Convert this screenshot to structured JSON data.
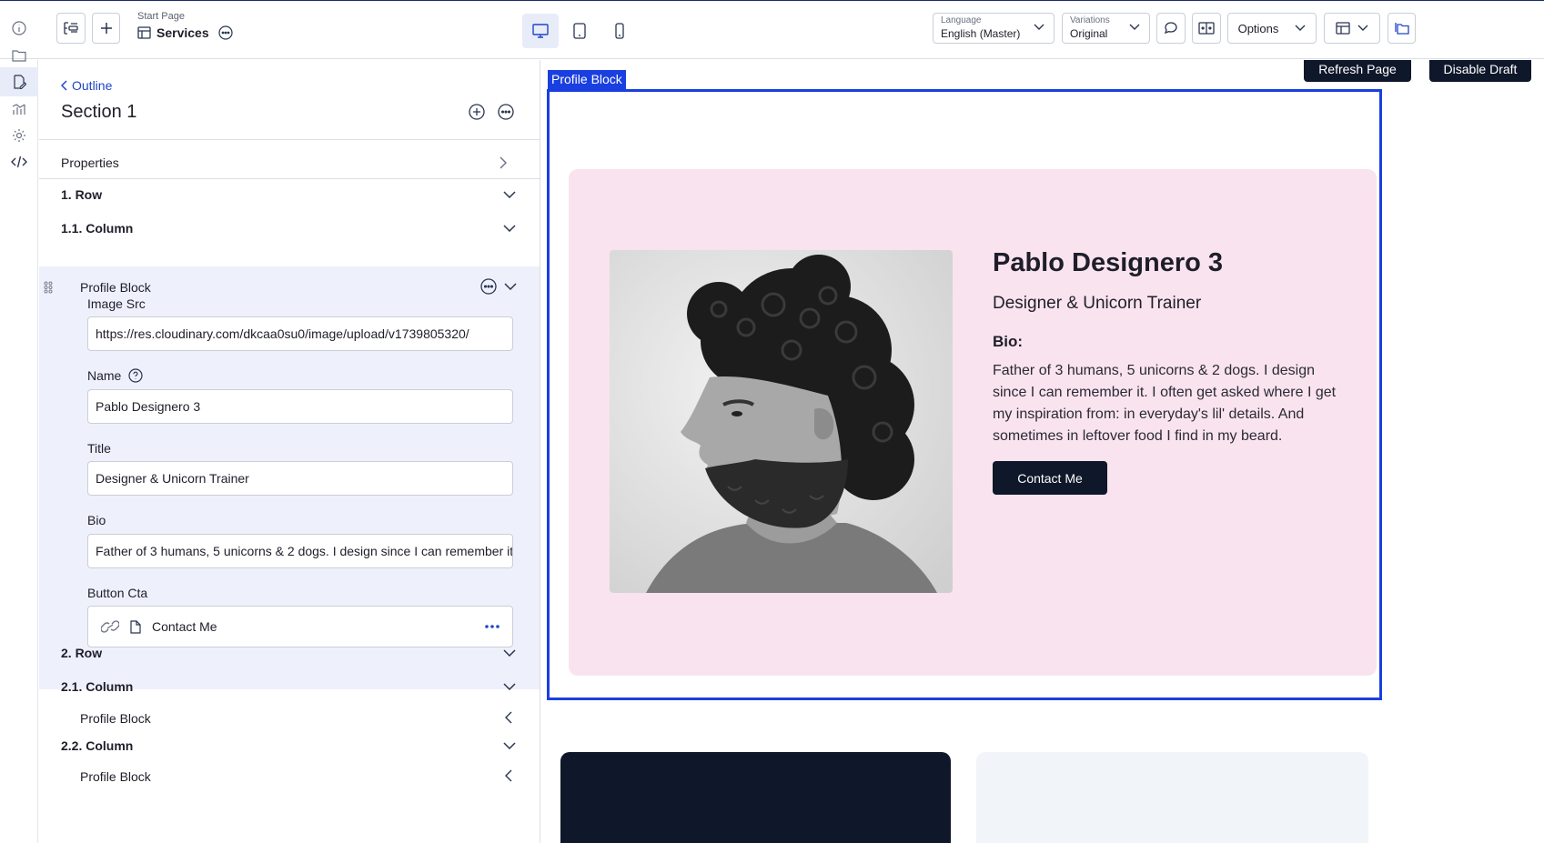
{
  "toolbar": {
    "breadcrumb_parent": "Start Page",
    "page_name": "Services",
    "language": {
      "label": "Language",
      "value": "English (Master)"
    },
    "variations": {
      "label": "Variations",
      "value": "Original"
    },
    "options_label": "Options"
  },
  "panel": {
    "outline_link": "Outline",
    "section_title": "Section 1",
    "properties_label": "Properties",
    "tree": [
      {
        "label": "1. Row"
      },
      {
        "label": "1.1. Column"
      }
    ],
    "profile_block": {
      "title": "Profile Block",
      "fields": {
        "image_src": {
          "label": "Image Src",
          "value": "https://res.cloudinary.com/dkcaa0su0/image/upload/v1739805320/"
        },
        "name": {
          "label": "Name",
          "value": "Pablo Designero 3"
        },
        "title": {
          "label": "Title",
          "value": "Designer & Unicorn Trainer"
        },
        "bio": {
          "label": "Bio",
          "value": "Father of 3 humans, 5 unicorns & 2 dogs. I design since I can remember it."
        },
        "button_cta": {
          "label": "Button Cta",
          "value": "Contact Me"
        }
      }
    },
    "tree_after": [
      {
        "label": "2. Row"
      },
      {
        "label": "2.1. Column"
      },
      {
        "label": "Profile Block"
      },
      {
        "label": "2.2. Column"
      },
      {
        "label": "Profile Block"
      }
    ]
  },
  "preview": {
    "refresh_button": "Refresh Page",
    "disable_draft_button": "Disable Draft",
    "selection_tag": "Profile Block",
    "profile": {
      "name": "Pablo Designero 3",
      "title": "Designer & Unicorn Trainer",
      "bio_label": "Bio:",
      "bio": "Father of 3 humans, 5 unicorns & 2 dogs. I design since I can remember it. I often get asked where I get my inspiration from: in everyday's lil' details. And sometimes in leftover food I find in my beard.",
      "cta": "Contact Me"
    }
  },
  "colors": {
    "accent": "#1a3fe0",
    "link": "#2145c8",
    "dark_button": "#0f172a",
    "card_bg": "#f9e3ee",
    "panel_highlight": "#eef1fb"
  }
}
